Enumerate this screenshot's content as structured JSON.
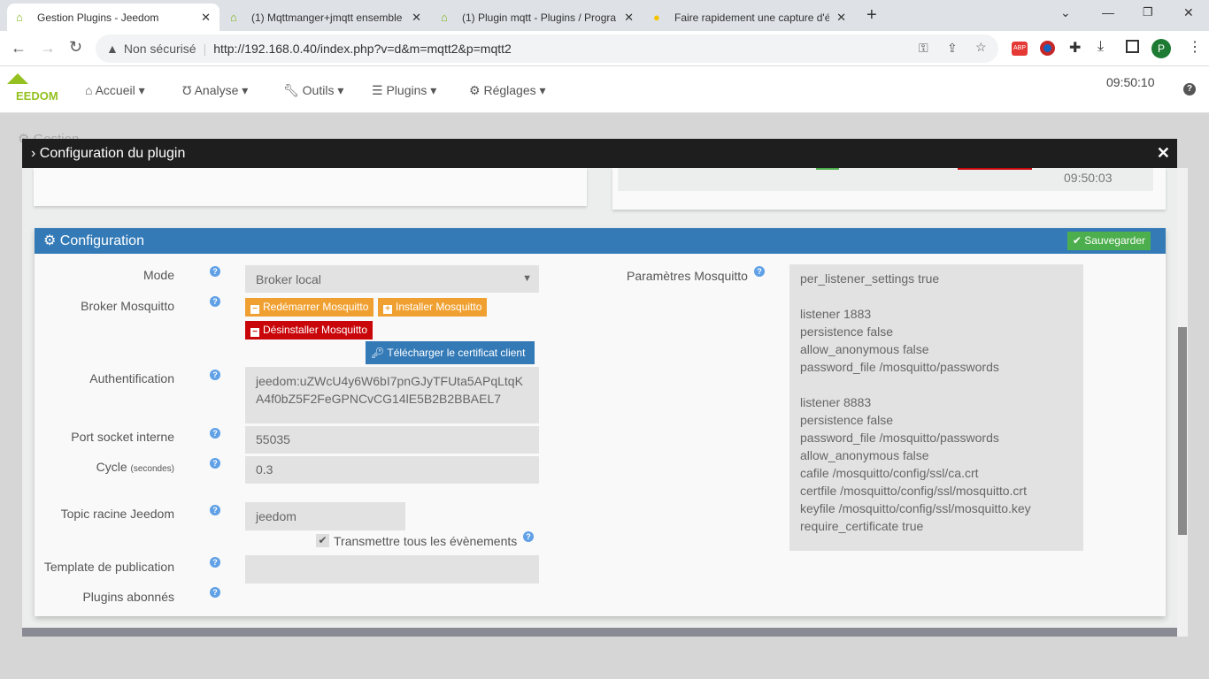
{
  "browser": {
    "tabs": [
      {
        "title": "Gestion Plugins - Jeedom",
        "active": true
      },
      {
        "title": "(1) Mqttmanger+jmqtt ensemble",
        "active": false
      },
      {
        "title": "(1) Plugin mqtt - Plugins / Progra",
        "active": false
      },
      {
        "title": "Faire rapidement une capture d'é",
        "active": false
      }
    ],
    "security": "Non sécurisé",
    "url": "http://192.168.0.40/index.php?v=d&m=mqtt2&p=mqtt2",
    "profile_initial": "P"
  },
  "nav": {
    "logo": "EEDOM",
    "items": [
      "Accueil",
      "Analyse",
      "Outils",
      "Plugins",
      "Réglages"
    ],
    "clock": "09:50:10",
    "help": "?"
  },
  "background": {
    "title": "Gestion"
  },
  "modal": {
    "title": "Configuration du plugin",
    "status_time": "09:50:03",
    "panel_title": "Configuration",
    "save": "Sauvegarder",
    "fields": {
      "mode_label": "Mode",
      "mode_value": "Broker local",
      "broker_label": "Broker Mosquitto",
      "restart": "Redémarrer Mosquitto",
      "install": "Installer Mosquitto",
      "uninstall": "Désinstaller Mosquitto",
      "download_cert": "Télécharger le certificat client",
      "auth_label": "Authentification",
      "auth_value": "jeedom:uZWcU4y6W6bI7pnGJyTFUta5APqLtqK\nA4f0bZ5F2FeGPNCvCG14lE5B2B2BBAEL7",
      "port_label": "Port socket interne",
      "port_value": "55035",
      "cycle_label": "Cycle",
      "cycle_unit": "(secondes)",
      "cycle_value": "0.3",
      "topic_label": "Topic racine Jeedom",
      "topic_value": "jeedom",
      "transmit_label": "Transmettre tous les évènements",
      "transmit_checked": true,
      "template_label": "Template de publication",
      "template_value": "",
      "plugins_label": "Plugins abonnés",
      "mosq_label": "Paramètres Mosquitto",
      "mosq_value": "per_listener_settings true\n\nlistener 1883\npersistence false\nallow_anonymous false\npassword_file /mosquitto/passwords\n\nlistener 8883\npersistence false\npassword_file /mosquitto/passwords\nallow_anonymous false\ncafile /mosquitto/config/ssl/ca.crt\ncertfile /mosquitto/config/ssl/mosquitto.crt\nkeyfile /mosquitto/config/ssl/mosquitto.key\nrequire_certificate true"
    }
  },
  "colors": {
    "primary": "#337ab7",
    "warning": "#f0a030",
    "danger": "#c9060a",
    "success": "#4cae4c"
  }
}
